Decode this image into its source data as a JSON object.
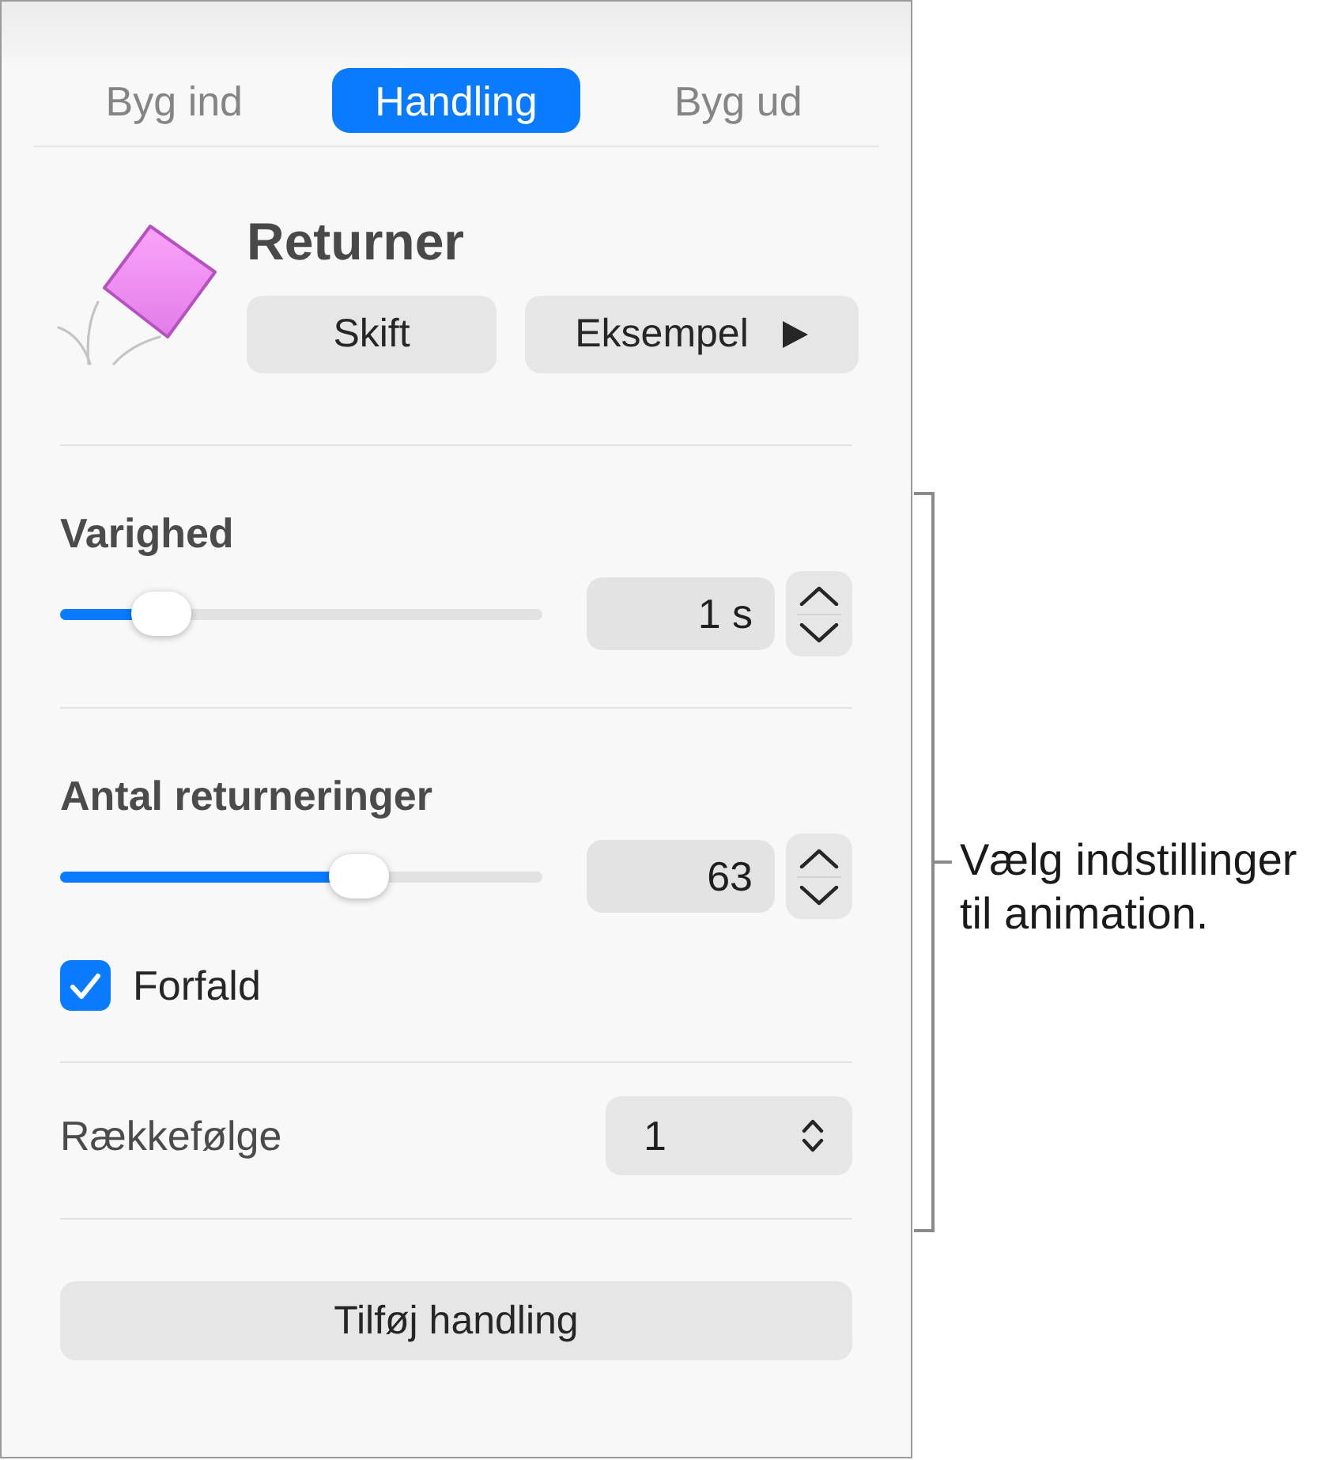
{
  "tabs": [
    {
      "label": "Byg ind",
      "selected": false
    },
    {
      "label": "Handling",
      "selected": true
    },
    {
      "label": "Byg ud",
      "selected": false
    }
  ],
  "effect": {
    "title": "Returner",
    "buttons": [
      {
        "label": "Skift",
        "kind": "text"
      },
      {
        "label": "Eksempel",
        "kind": "play"
      }
    ]
  },
  "sections": [
    {
      "items": [
        {
          "kind": "slider",
          "label": "Varighed",
          "level": 0.21,
          "value": "1 s"
        }
      ]
    },
    {
      "items": [
        {
          "kind": "slider",
          "label": "Antal returneringer",
          "level": 0.62,
          "value": "63"
        },
        {
          "kind": "checkbox",
          "label": "Forfald",
          "checked": true
        }
      ]
    },
    {
      "items": [
        {
          "kind": "popup",
          "label": "Rækkefølge",
          "value": "1"
        }
      ]
    }
  ],
  "add_button": {
    "label": "Tilføj handling"
  },
  "callout": {
    "text": "Vælg indstillinger til animation."
  }
}
